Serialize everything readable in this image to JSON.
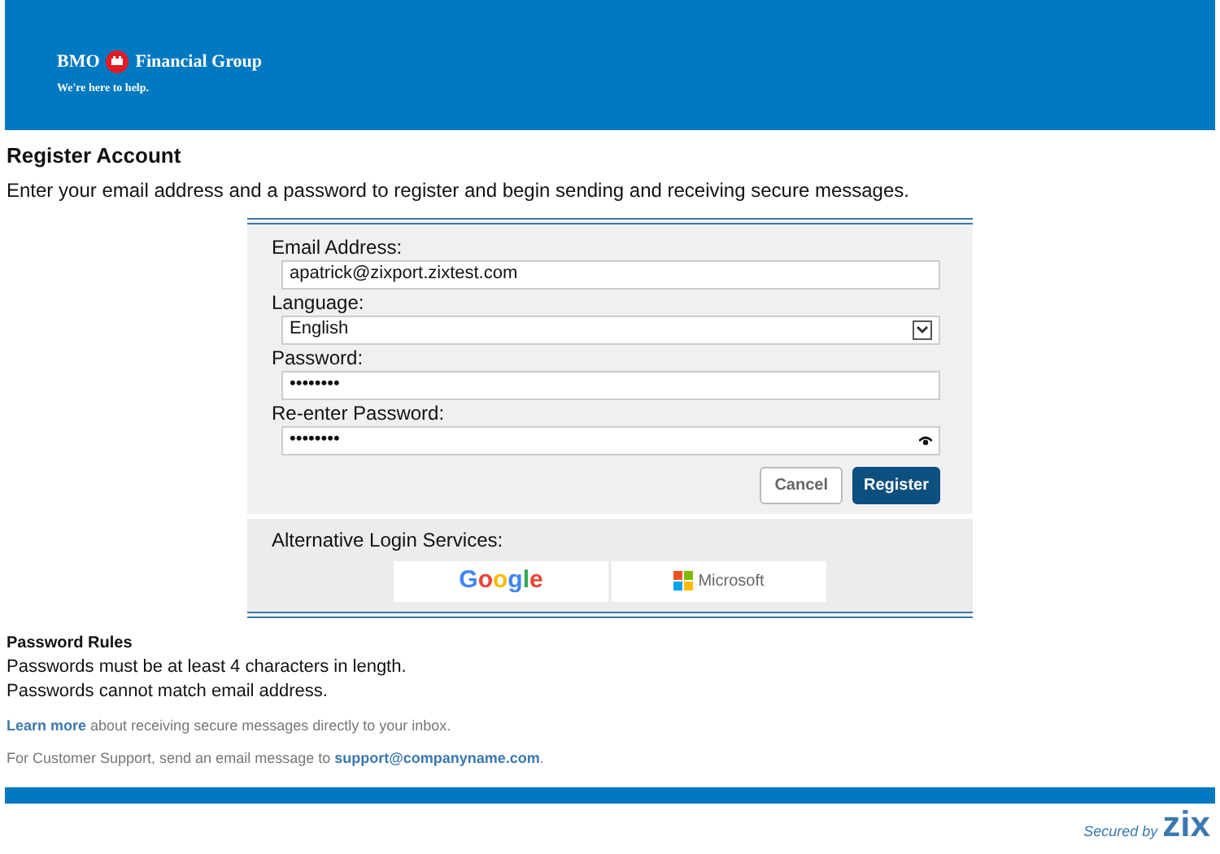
{
  "header": {
    "brand": "BMO",
    "brand_suffix": "Financial Group",
    "tagline": "We're here to help."
  },
  "title": "Register Account",
  "intro": "Enter your email address and a password to register and begin sending and receiving secure messages.",
  "form": {
    "fields": [
      {
        "kind": "text",
        "label": "Email Address:",
        "value": "apatrick@zixport.zixtest.com"
      },
      {
        "kind": "select",
        "label": "Language:",
        "value": "English"
      },
      {
        "kind": "password",
        "label": "Password:",
        "value": "••••••••"
      },
      {
        "kind": "password-reveal",
        "label": "Re-enter Password:",
        "value": "••••••••"
      }
    ],
    "buttons": [
      {
        "label": "Cancel",
        "kind": "secondary"
      },
      {
        "label": "Register",
        "kind": "primary"
      }
    ],
    "alt_login": {
      "label": "Alternative Login Services:",
      "providers": [
        {
          "kind": "google",
          "label": "Google"
        },
        {
          "kind": "microsoft",
          "label": "Microsoft"
        }
      ]
    }
  },
  "rules": {
    "title": "Password Rules",
    "items": [
      "Passwords must be at least 4 characters in length.",
      "Passwords cannot match email address."
    ]
  },
  "learn_more": {
    "link": "Learn more",
    "text": "about receiving secure messages directly to your inbox."
  },
  "support": {
    "text": "For Customer Support, send an email message to",
    "email": "support@companyname.com",
    "end": "."
  },
  "footer": {
    "secured_by": "Secured by",
    "logo": "zix"
  }
}
